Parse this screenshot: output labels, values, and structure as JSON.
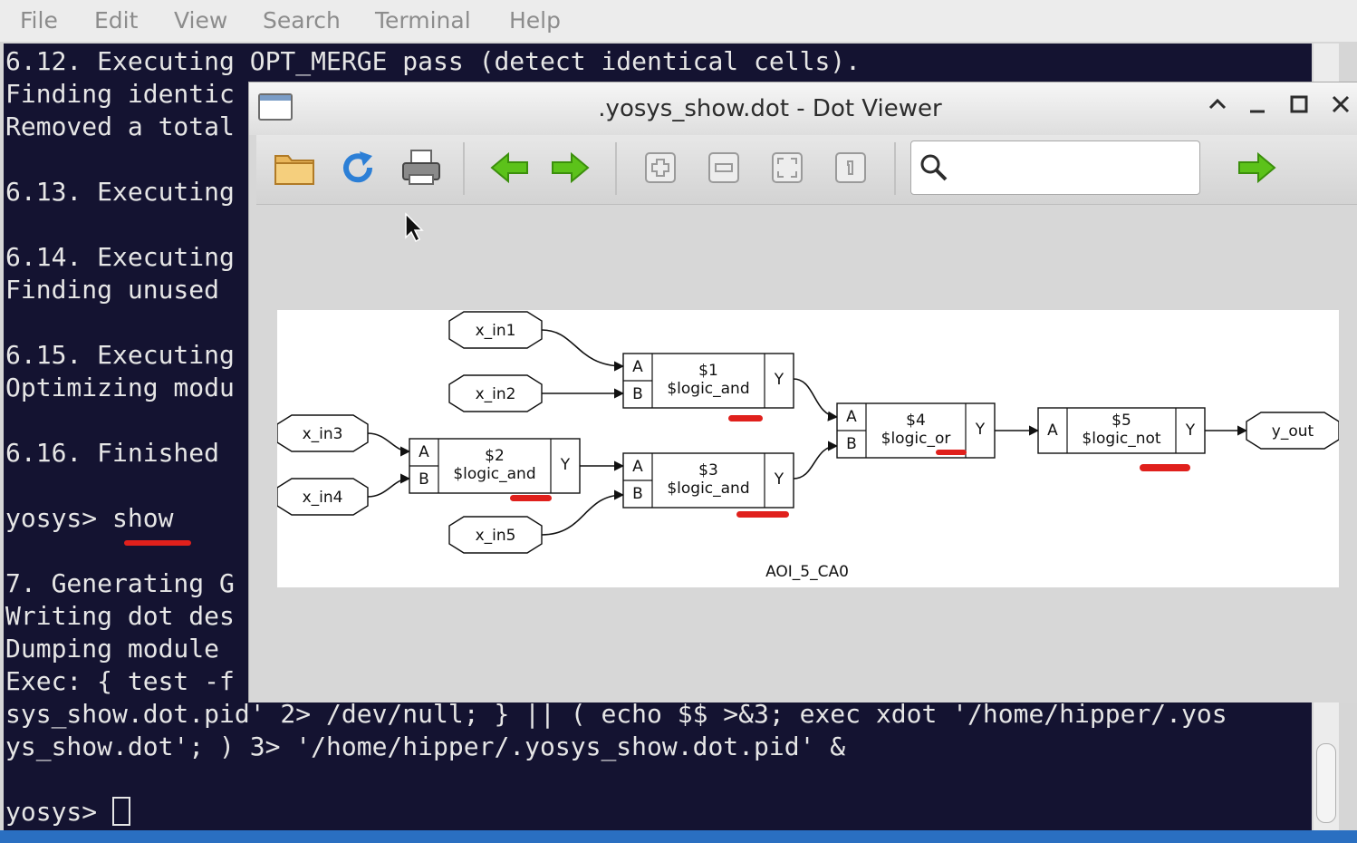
{
  "menubar": {
    "items": [
      "File",
      "Edit",
      "View",
      "Search",
      "Terminal",
      "Help"
    ]
  },
  "terminal": {
    "lines": [
      "6.12. Executing OPT_MERGE pass (detect identical cells).",
      "Finding identic",
      "Removed a total",
      "",
      "6.13. Executing",
      "",
      "6.14. Executing",
      "Finding unused",
      "",
      "6.15. Executing",
      "Optimizing modu",
      "",
      "6.16. Finished",
      "",
      "yosys> show",
      "",
      "7. Generating G",
      "Writing dot des",
      "Dumping module",
      "Exec: { test -f",
      "sys_show.dot.pid' 2> /dev/null; } || ( echo $$ >&3; exec xdot '/home/hipper/.yos",
      "ys_show.dot'; ) 3> '/home/hipper/.yosys_show.dot.pid' &",
      "",
      "yosys> "
    ]
  },
  "viewer": {
    "title": ".yosys_show.dot - Dot Viewer",
    "window_buttons": [
      "^",
      "_",
      "□",
      "×"
    ],
    "toolbar": {
      "icons": [
        "folder-open-icon",
        "reload-icon",
        "print-icon",
        "back-arrow-icon",
        "forward-arrow-icon",
        "zoom-in-icon",
        "zoom-out-icon",
        "zoom-fit-icon",
        "zoom-100-icon",
        "search-icon",
        "find-next-icon"
      ],
      "search_placeholder": ""
    }
  },
  "graph": {
    "caption": "AOI_5_CA0",
    "inputs": [
      "x_in1",
      "x_in2",
      "x_in3",
      "x_in4",
      "x_in5"
    ],
    "output": "y_out",
    "cells": [
      {
        "id": "$1",
        "type": "$logic_and",
        "ports_in": [
          "A",
          "B"
        ],
        "port_out": "Y"
      },
      {
        "id": "$2",
        "type": "$logic_and",
        "ports_in": [
          "A",
          "B"
        ],
        "port_out": "Y"
      },
      {
        "id": "$3",
        "type": "$logic_and",
        "ports_in": [
          "A",
          "B"
        ],
        "port_out": "Y"
      },
      {
        "id": "$4",
        "type": "$logic_or",
        "ports_in": [
          "A",
          "B"
        ],
        "port_out": "Y"
      },
      {
        "id": "$5",
        "type": "$logic_not",
        "ports_in": [
          "A"
        ],
        "port_out": "Y"
      }
    ]
  },
  "colors": {
    "terminal_bg": "#141331",
    "annotation_red": "#e0201c",
    "arrow_green": "#5cc21a"
  }
}
